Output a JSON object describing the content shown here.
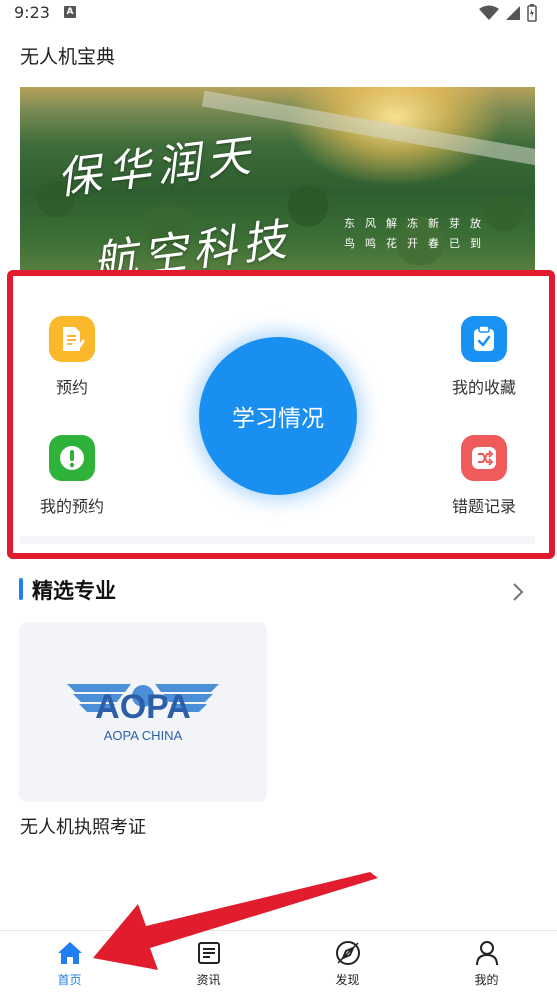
{
  "status_bar": {
    "time": "9:23",
    "notification_letter": "A"
  },
  "header": {
    "title": "无人机宝典"
  },
  "banner": {
    "line1": "保华润天",
    "line2": "航空科技",
    "sub1": "东风解冻新芽放",
    "sub2": "鸟鸣花开春已到"
  },
  "quick_menu": {
    "booking": "预约",
    "my_bookings": "我的预约",
    "my_favorites": "我的收藏",
    "wrong_questions": "错题记录",
    "study_status": "学习情况"
  },
  "featured": {
    "title": "精选专业",
    "courses": [
      {
        "name": "无人机执照考证",
        "logo_text": "AOPA",
        "logo_subtext": "AOPA CHINA"
      }
    ]
  },
  "tabbar": {
    "tabs": [
      {
        "label": "首页",
        "icon": "home-icon",
        "active": true
      },
      {
        "label": "资讯",
        "icon": "news-icon",
        "active": false
      },
      {
        "label": "发现",
        "icon": "discover-icon",
        "active": false
      },
      {
        "label": "我的",
        "icon": "profile-icon",
        "active": false
      }
    ]
  },
  "colors": {
    "accent_blue": "#1f7ef0",
    "study_circle": "#1a8ff2",
    "highlight_red": "#e11c2c",
    "booking_icon": "#fbb82a",
    "my_booking_icon": "#2fb23a",
    "favorites_icon": "#1892f5",
    "wrong_icon": "#ef5b5b"
  }
}
